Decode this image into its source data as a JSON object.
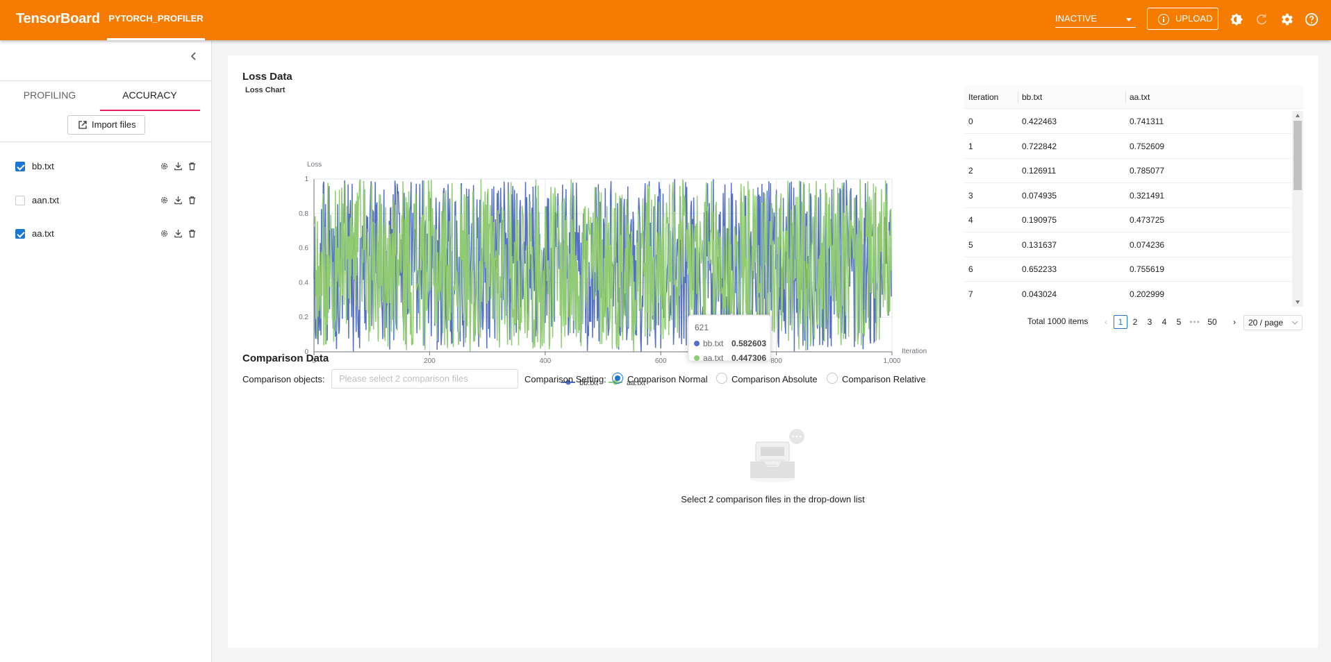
{
  "header": {
    "brand": "TensorBoard",
    "plugin_tab": "PYTORCH_PROFILER",
    "run_select": "INACTIVE",
    "upload_label": "UPLOAD",
    "icons": [
      "theme-icon",
      "refresh-icon",
      "settings-icon",
      "help-icon"
    ]
  },
  "sidebar": {
    "tabs": [
      "PROFILING",
      "ACCURACY"
    ],
    "active_tab": "ACCURACY",
    "import_label": "Import files",
    "files": [
      {
        "name": "bb.txt",
        "checked": true
      },
      {
        "name": "aan.txt",
        "checked": false
      },
      {
        "name": "aa.txt",
        "checked": true
      }
    ]
  },
  "loss": {
    "section_title": "Loss Data",
    "chart_title": "Loss Chart",
    "tooltip": {
      "x": "621",
      "rows": [
        {
          "name": "bb.txt",
          "value": "0.582603"
        },
        {
          "name": "aa.txt",
          "value": "0.447306"
        }
      ]
    }
  },
  "table": {
    "columns": [
      "Iteration",
      "bb.txt",
      "aa.txt"
    ],
    "rows": [
      [
        "0",
        "0.422463",
        "0.741311"
      ],
      [
        "1",
        "0.722842",
        "0.752609"
      ],
      [
        "2",
        "0.126911",
        "0.785077"
      ],
      [
        "3",
        "0.074935",
        "0.321491"
      ],
      [
        "4",
        "0.190975",
        "0.473725"
      ],
      [
        "5",
        "0.131637",
        "0.074236"
      ],
      [
        "6",
        "0.652233",
        "0.755619"
      ],
      [
        "7",
        "0.043024",
        "0.202999"
      ]
    ],
    "total": "Total 1000 items",
    "pages": [
      "1",
      "2",
      "3",
      "4",
      "5",
      "50"
    ],
    "active_page": "1",
    "page_size": "20 / page"
  },
  "comparison": {
    "title": "Comparison Data",
    "objects_label": "Comparison objects:",
    "objects_placeholder": "Please select 2 comparison files",
    "setting_label": "Comparison Setting:",
    "options": [
      "Comparison Normal",
      "Comparison Absolute",
      "Comparison Relative"
    ],
    "selected": "Comparison Normal",
    "empty_message": "Select 2 comparison files in the drop-down list"
  },
  "chart_data": {
    "type": "line",
    "title": "Loss Chart",
    "ylabel": "Loss",
    "xlabel": "Iteration",
    "xlim": [
      0,
      1000
    ],
    "ylim": [
      0,
      1
    ],
    "x_ticks": [
      "0",
      "200",
      "400",
      "600",
      "800",
      "1,000"
    ],
    "y_ticks": [
      "0",
      "0.2",
      "0.4",
      "0.6",
      "0.8",
      "1"
    ],
    "legend_position": "bottom-center",
    "grid": true,
    "series": [
      {
        "name": "bb.txt",
        "color": "#5470c6",
        "values_first": [
          0.422463,
          0.722842,
          0.126911,
          0.074935,
          0.190975,
          0.131637,
          0.652233,
          0.043024
        ],
        "values_note": "1000 random values in [0,1]"
      },
      {
        "name": "aa.txt",
        "color": "#91cc75",
        "values_first": [
          0.741311,
          0.752609,
          0.785077,
          0.321491,
          0.473725,
          0.074236,
          0.755619,
          0.202999
        ],
        "values_note": "1000 random values in [0,1]"
      }
    ]
  }
}
